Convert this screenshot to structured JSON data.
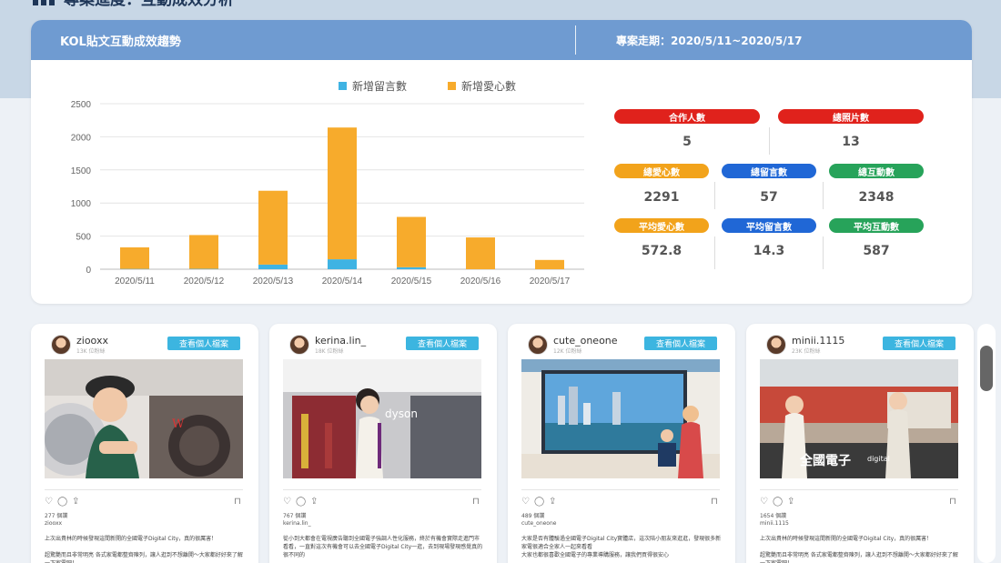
{
  "page": {
    "title": "專案進度：互動成效分析"
  },
  "stats": {
    "title": "KOL貼文互動成效趨勢",
    "period": "專案走期：2020/5/11~2020/5/17",
    "metrics": [
      {
        "label": "合作人數",
        "value": "5",
        "color": "#e0221c"
      },
      {
        "label": "總照片數",
        "value": "13",
        "color": "#e0221c"
      },
      {
        "label": "總愛心數",
        "value": "2291",
        "color": "#f2a31b"
      },
      {
        "label": "總留言數",
        "value": "57",
        "color": "#2067d6"
      },
      {
        "label": "總互動數",
        "value": "2348",
        "color": "#27a35a"
      },
      {
        "label": "平均愛心數",
        "value": "572.8",
        "color": "#f2a31b"
      },
      {
        "label": "平均留言數",
        "value": "14.3",
        "color": "#2067d6"
      },
      {
        "label": "平均互動數",
        "value": "587",
        "color": "#27a35a"
      }
    ]
  },
  "chart_data": {
    "type": "bar",
    "stacked": true,
    "categories": [
      "2020/5/11",
      "2020/5/12",
      "2020/5/13",
      "2020/5/14",
      "2020/5/15",
      "2020/5/16",
      "2020/5/17"
    ],
    "series": [
      {
        "name": "新增留言數",
        "color": "#3fb3e3",
        "values": [
          5,
          6,
          70,
          150,
          30,
          0,
          0
        ]
      },
      {
        "name": "新增愛心數",
        "color": "#f7ab2c",
        "values": [
          325,
          510,
          1115,
          1990,
          760,
          480,
          140
        ]
      }
    ],
    "ylim": [
      0,
      2500
    ],
    "yticks": [
      0,
      500,
      1000,
      1500,
      2000,
      2500
    ],
    "legend": "top-center",
    "grid": true
  },
  "posts": [
    {
      "username": "ziooxx",
      "followers": "13K 位粉絲",
      "button": "查看個人檔案",
      "likes": "277 個讚",
      "handle": "ziooxx",
      "caption1": "上次出貴林的時候發現這間新開的全國電子Digital City，真的很厲害！",
      "caption2": "超驚艷而且非常明亮 各式家電都整齊陳列，讓人逛到不想離開～大家都好好來了解一下家電吧！",
      "photo": "washer"
    },
    {
      "username": "kerina.lin_",
      "followers": "18K 位粉絲",
      "button": "查看個人檔案",
      "likes": "767 個讚",
      "handle": "kerina.lin_",
      "caption1": "從小到大都會在電視廣告聽到全國電子強調人性化服務，終於有機會實際走進門市看看，一直對這次有機會可以去全國電子Digital City一逛，去到現場發現感覺真的很不同的",
      "caption2": "",
      "photo": "dyson"
    },
    {
      "username": "cute_oneone",
      "followers": "12K 位粉絲",
      "button": "查看個人檔案",
      "likes": "489 個讚",
      "handle": "cute_oneone",
      "caption1": "大家是否有體驗過全國電子Digital City實體店，這次陪小朋友來逛逛，發現很多新家電很適合全家人一起來看看",
      "caption2": "大家也都很喜歡全國電子的專業導購服務，讓我們買得很安心",
      "photo": "tv"
    },
    {
      "username": "minii.1115",
      "followers": "23K 位粉絲",
      "button": "查看個人檔案",
      "likes": "1654 個讚",
      "handle": "minii.1115",
      "caption1": "上次出貴林的時候發現這間新開的全國電子Digital City，真的很厲害！",
      "caption2": "超驚艷而且非常明亮 各式家電都整齊陳列，讓人逛到不想離開～大家都好好來了解一下家電吧！",
      "photo": "store"
    }
  ]
}
